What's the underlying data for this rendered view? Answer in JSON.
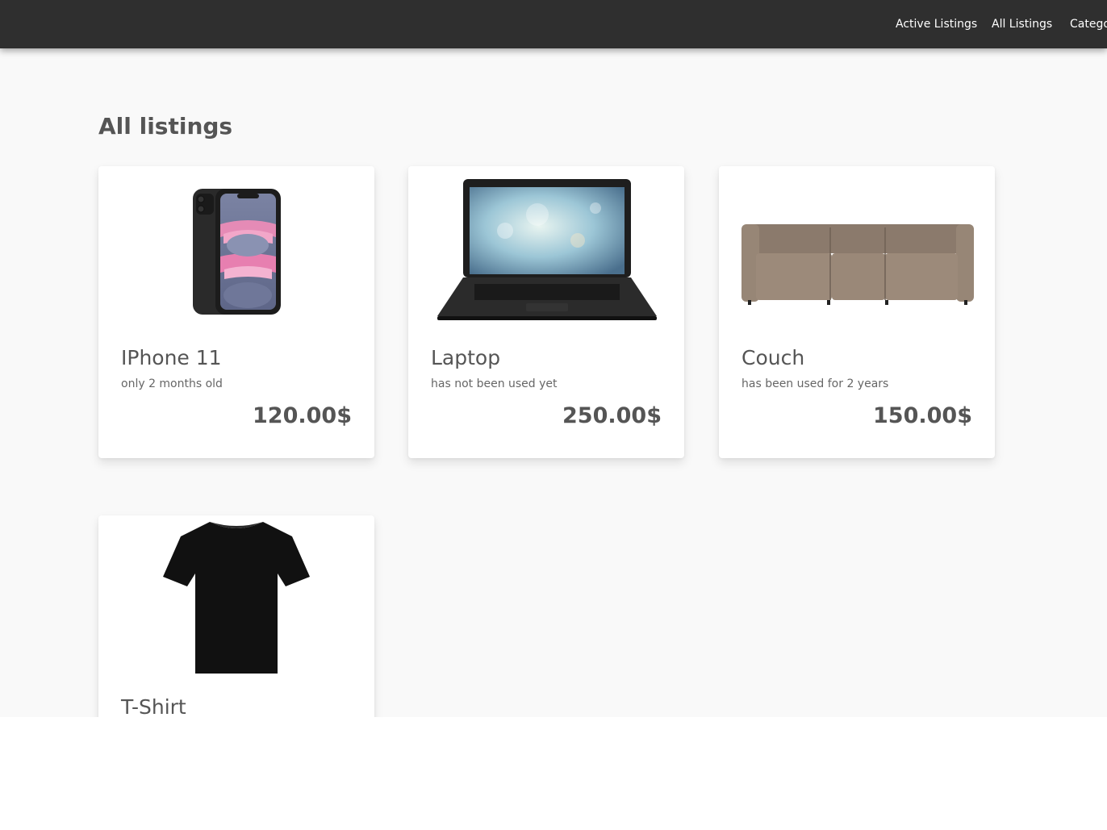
{
  "nav": {
    "items": [
      {
        "label": "Active Listings"
      },
      {
        "label": "All Listings"
      },
      {
        "label": "Categories"
      }
    ]
  },
  "page": {
    "title": "All listings"
  },
  "listings": [
    {
      "title": "IPhone 11",
      "description": "only 2 months old",
      "price": "120.00$",
      "image_icon": "smartphone-icon"
    },
    {
      "title": "Laptop",
      "description": "has not been used yet",
      "price": "250.00$",
      "image_icon": "laptop-icon"
    },
    {
      "title": "Couch",
      "description": "has been used for 2 years",
      "price": "150.00$",
      "image_icon": "couch-icon"
    },
    {
      "title": "T-Shirt",
      "description": "",
      "price": "",
      "image_icon": "tshirt-icon"
    }
  ],
  "colors": {
    "navbar": "#2f2f2f",
    "background": "#f9f9f9",
    "text": "#555555"
  }
}
